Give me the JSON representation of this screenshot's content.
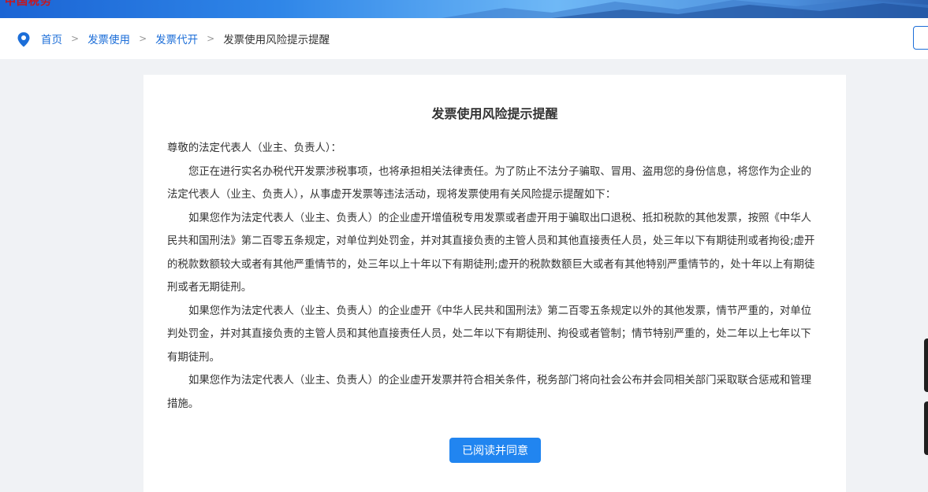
{
  "header": {
    "logo_text": "中国税务"
  },
  "breadcrumb": {
    "items": [
      "首页",
      "发票使用",
      "发票代开"
    ],
    "current": "发票使用风险提示提醒",
    "separator": ">"
  },
  "notice": {
    "title": "发票使用风险提示提醒",
    "salutation": "尊敬的法定代表人（业主、负责人）：",
    "paragraphs": [
      "您正在进行实名办税代开发票涉税事项，也将承担相关法律责任。为了防止不法分子骗取、冒用、盗用您的身份信息，将您作为企业的法定代表人（业主、负责人），从事虚开发票等违法活动，现将发票使用有关风险提示提醒如下：",
      "如果您作为法定代表人（业主、负责人）的企业虚开增值税专用发票或者虚开用于骗取出口退税、抵扣税款的其他发票，按照《中华人民共和国刑法》第二百零五条规定，对单位判处罚金，并对其直接负责的主管人员和其他直接责任人员，处三年以下有期徒刑或者拘役;虚开的税款数额较大或者有其他严重情节的，处三年以上十年以下有期徒刑;虚开的税款数额巨大或者有其他特别严重情节的，处十年以上有期徒刑或者无期徒刑。",
      "如果您作为法定代表人（业主、负责人）的企业虚开《中华人民共和国刑法》第二百零五条规定以外的其他发票，情节严重的，对单位判处罚金，并对其直接负责的主管人员和其他直接责任人员，处二年以下有期徒刑、拘役或者管制；情节特别严重的，处二年以上七年以下有期徒刑。",
      "如果您作为法定代表人（业主、负责人）的企业虚开发票并符合相关条件，税务部门将向社会公布并会同相关部门采取联合惩戒和管理措施。"
    ],
    "agree_label": "已阅读并同意"
  },
  "colors": {
    "accent": "#2185f0",
    "link": "#1c6ed8"
  }
}
